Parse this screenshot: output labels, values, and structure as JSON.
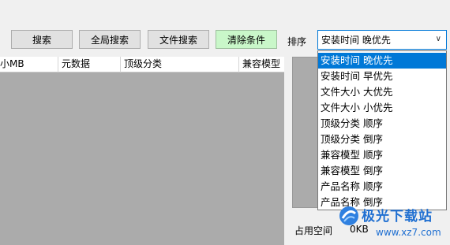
{
  "toolbar": {
    "search_label": "搜索",
    "global_search_label": "全局搜索",
    "file_search_label": "文件搜索",
    "clear_conditions_label": "清除条件"
  },
  "sort": {
    "label": "排序",
    "selected": "安装时间 晚优先",
    "options": [
      "安装时间 晚优先",
      "安装时间 早优先",
      "文件大小 大优先",
      "文件大小 小优先",
      "顶级分类 顺序",
      "顶级分类 倒序",
      "兼容模型 顺序",
      "兼容模型 倒序",
      "产品名称 顺序",
      "产品名称 倒序"
    ]
  },
  "table": {
    "columns": [
      "小MB",
      "元数据",
      "顶级分类",
      "兼容模型"
    ]
  },
  "status": {
    "space_label": "占用空间",
    "space_value": "0KB"
  },
  "watermark": {
    "brand": "极光下载站",
    "url": "www.xz7.com"
  },
  "colors": {
    "accent": "#0078d7",
    "clear_button_bg": "#c9f7c9",
    "grid_bg": "#ababab"
  }
}
